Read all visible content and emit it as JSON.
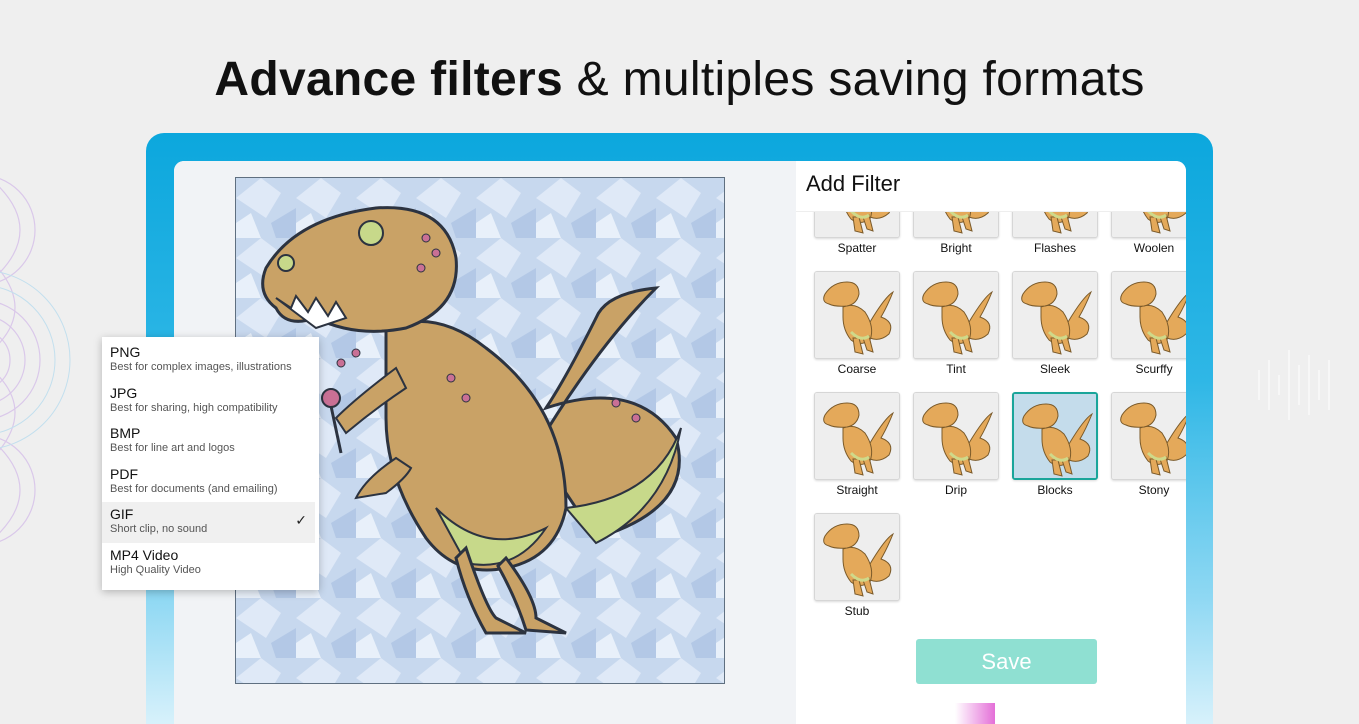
{
  "headline": {
    "bold": "Advance filters",
    "rest": " & multiples saving formats"
  },
  "panel": {
    "title": "Add Filter"
  },
  "filters": [
    {
      "label": "Spatter",
      "selected": false
    },
    {
      "label": "Bright",
      "selected": false
    },
    {
      "label": "Flashes",
      "selected": false
    },
    {
      "label": "Woolen",
      "selected": false
    },
    {
      "label": "Coarse",
      "selected": false
    },
    {
      "label": "Tint",
      "selected": false
    },
    {
      "label": "Sleek",
      "selected": false
    },
    {
      "label": "Scurffy",
      "selected": false
    },
    {
      "label": "Straight",
      "selected": false
    },
    {
      "label": "Drip",
      "selected": false
    },
    {
      "label": "Blocks",
      "selected": true
    },
    {
      "label": "Stony",
      "selected": false
    },
    {
      "label": "Stub",
      "selected": false
    }
  ],
  "save_label": "Save",
  "formats": [
    {
      "name": "PNG",
      "desc": "Best for complex images, illustrations",
      "selected": false
    },
    {
      "name": "JPG",
      "desc": "Best for sharing, high compatibility",
      "selected": false
    },
    {
      "name": "BMP",
      "desc": "Best for line art and logos",
      "selected": false
    },
    {
      "name": "PDF",
      "desc": "Best for documents (and emailing)",
      "selected": false
    },
    {
      "name": "GIF",
      "desc": "Short clip, no sound",
      "selected": true
    },
    {
      "name": "MP4 Video",
      "desc": "High Quality Video",
      "selected": false
    }
  ],
  "colors": {
    "accent": "#0ca7dd",
    "save": "#8fe0d2",
    "selection": "#1aa59a"
  }
}
